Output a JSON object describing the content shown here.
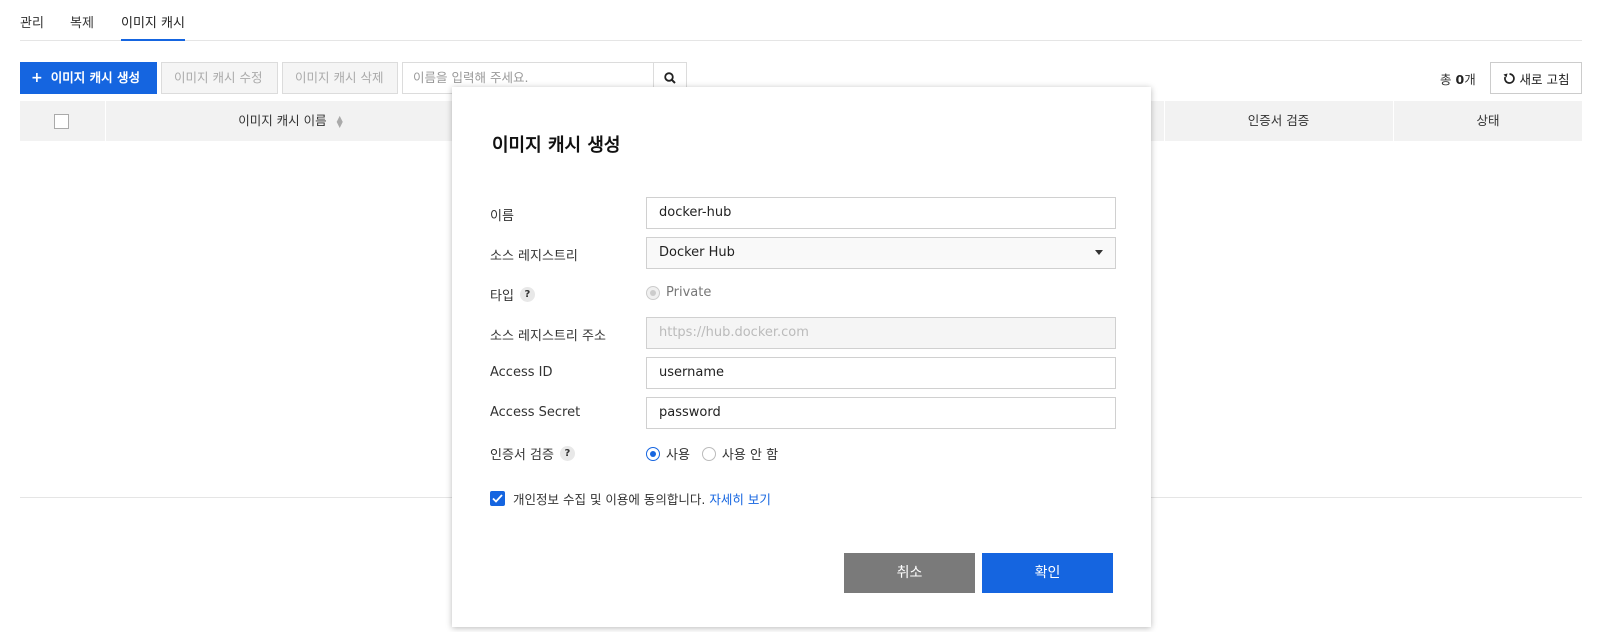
{
  "tabs": [
    {
      "label": "관리"
    },
    {
      "label": "복제"
    },
    {
      "label": "이미지 캐시"
    }
  ],
  "toolbar": {
    "create_label": "이미지 캐시 생성",
    "create_icon": "+",
    "edit_label": "이미지 캐시 수정",
    "delete_label": "이미지 캐시 삭제",
    "search_placeholder": "이름을 입력해 주세요.",
    "total_prefix": "총 ",
    "total_count": "0",
    "total_suffix": "개",
    "refresh_label": "새로 고침"
  },
  "table": {
    "columns": [
      "이미지 캐시 이름",
      "인증서 검증",
      "상태"
    ]
  },
  "modal": {
    "title": "이미지 캐시 생성",
    "name_label": "이름",
    "name_value": "docker-hub",
    "registry_label": "소스 레지스트리",
    "registry_value": "Docker Hub",
    "type_label": "타입",
    "type_value": "Private",
    "registry_address_label": "소스 레지스트리 주소",
    "registry_address_placeholder": "https://hub.docker.com",
    "access_id_label": "Access ID",
    "access_id_value": "username",
    "access_secret_label": "Access Secret",
    "access_secret_value": "password",
    "cert_label": "인증서 검증",
    "cert_on_label": "사용",
    "cert_off_label": "사용 안 함",
    "agree_text": "개인정보 수집 및 이용에 동의합니다.",
    "agree_link": "자세히 보기",
    "cancel_label": "취소",
    "ok_label": "확인",
    "help_glyph": "?"
  },
  "colors": {
    "accent": "#1565e0",
    "cancel": "#7a7a7a"
  }
}
